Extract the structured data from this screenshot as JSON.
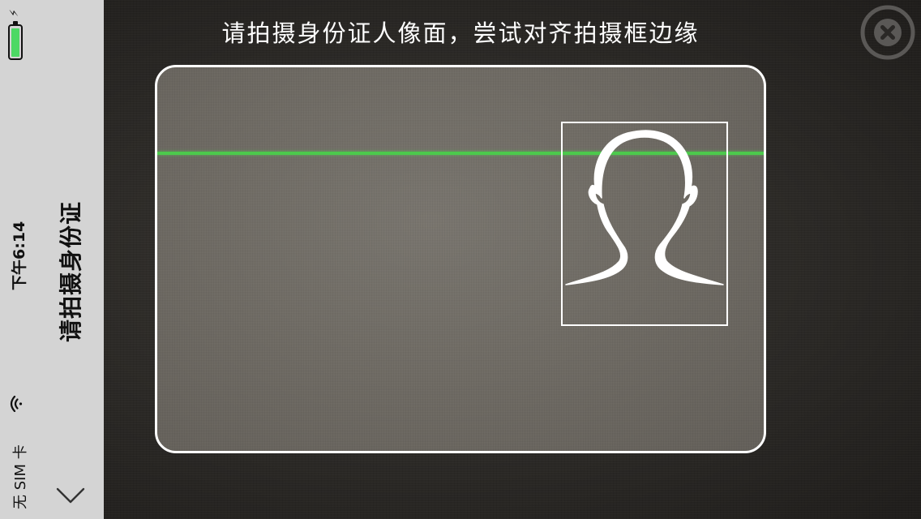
{
  "status_bar": {
    "carrier": "无 SIM 卡",
    "time": "下午6:14",
    "battery_color": "#4cd964"
  },
  "sidebar": {
    "title": "请拍摄身份证",
    "collapse_icon": "chevron-down-icon"
  },
  "overlay": {
    "instruction": "请拍摄身份证人像面，尝试对齐拍摄框边缘",
    "close_icon": "close-icon",
    "scan_line_color": "#4cc94c"
  }
}
